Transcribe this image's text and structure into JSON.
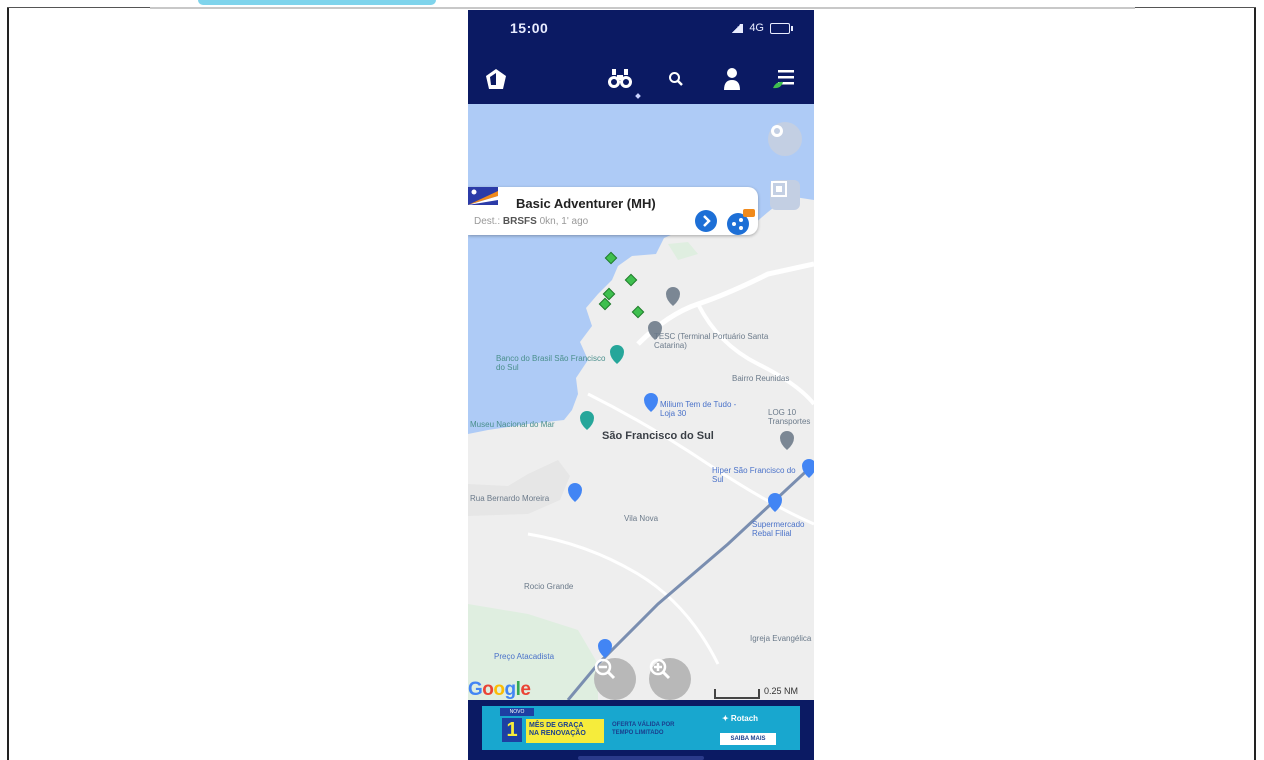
{
  "statusbar": {
    "time": "15:00",
    "signal_text": "4G"
  },
  "appbar": {
    "icons": [
      "home-icon",
      "binoculars-icon",
      "search-icon",
      "user-icon",
      "menu-icon"
    ]
  },
  "popup": {
    "title": "Basic Adventurer (MH)",
    "dest_label": "Dest.:",
    "dest_value": "BRSFS",
    "dest_meta": "0kn, 1' ago"
  },
  "map": {
    "labels": {
      "city": "São Francisco do Sul",
      "poi_terminal": "TESC (Terminal Portuário Santa Catarina)",
      "poi_bank": "Banco do Brasil São Francisco do Sul",
      "poi_museum": "Museu Nacional do Mar",
      "poi_store": "Milium Tem de Tudo - Loja 30",
      "poi_other": "LOG 10 Transportes",
      "poi_hiper": "Hiper São Francisco do Sul",
      "poi_super": "Supermercado Rebal Filial",
      "poi_preco": "Preço Atacadista",
      "poi_church": "Igreja Evangélica",
      "area_north": "Bairro Reunidas",
      "area_mid": "Vila Nova",
      "area_south": "Rocio Grande",
      "area_left": "Rua Bernardo Moreira"
    },
    "google": "Google",
    "scale": "0.25 NM"
  },
  "ad": {
    "badge": "NOVO",
    "number": "1",
    "line1": "MÊS DE GRAÇA",
    "line2": "NA RENOVAÇÃO",
    "offer1": "OFERTA VÁLIDA POR",
    "offer2": "TEMPO LIMITADO",
    "brand": "✦ Rotach",
    "cta": "SAIBA MAIS"
  },
  "colors": {
    "nav_bg": "#0b1a63",
    "water": "#aecbf6",
    "land": "#eeeeee",
    "route": "#7a8eb0",
    "vessel": "#3fbf4f",
    "pin_blue": "#4285f4",
    "pin_teal": "#26a69a",
    "pin_gray": "#7b8794"
  }
}
